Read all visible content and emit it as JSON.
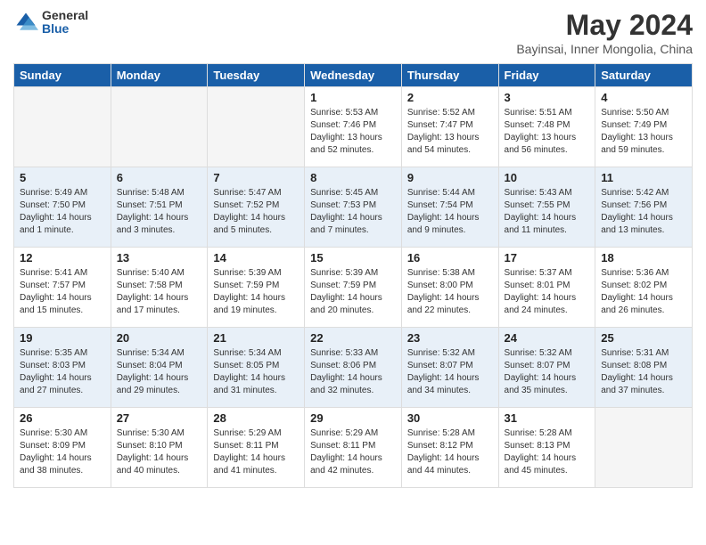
{
  "logo": {
    "general": "General",
    "blue": "Blue"
  },
  "title": "May 2024",
  "location": "Bayinsai, Inner Mongolia, China",
  "headers": [
    "Sunday",
    "Monday",
    "Tuesday",
    "Wednesday",
    "Thursday",
    "Friday",
    "Saturday"
  ],
  "weeks": [
    [
      {
        "day": "",
        "sunrise": "",
        "sunset": "",
        "daylight": "",
        "empty": true
      },
      {
        "day": "",
        "sunrise": "",
        "sunset": "",
        "daylight": "",
        "empty": true
      },
      {
        "day": "",
        "sunrise": "",
        "sunset": "",
        "daylight": "",
        "empty": true
      },
      {
        "day": "1",
        "sunrise": "Sunrise: 5:53 AM",
        "sunset": "Sunset: 7:46 PM",
        "daylight": "Daylight: 13 hours and 52 minutes.",
        "empty": false
      },
      {
        "day": "2",
        "sunrise": "Sunrise: 5:52 AM",
        "sunset": "Sunset: 7:47 PM",
        "daylight": "Daylight: 13 hours and 54 minutes.",
        "empty": false
      },
      {
        "day": "3",
        "sunrise": "Sunrise: 5:51 AM",
        "sunset": "Sunset: 7:48 PM",
        "daylight": "Daylight: 13 hours and 56 minutes.",
        "empty": false
      },
      {
        "day": "4",
        "sunrise": "Sunrise: 5:50 AM",
        "sunset": "Sunset: 7:49 PM",
        "daylight": "Daylight: 13 hours and 59 minutes.",
        "empty": false
      }
    ],
    [
      {
        "day": "5",
        "sunrise": "Sunrise: 5:49 AM",
        "sunset": "Sunset: 7:50 PM",
        "daylight": "Daylight: 14 hours and 1 minute.",
        "empty": false
      },
      {
        "day": "6",
        "sunrise": "Sunrise: 5:48 AM",
        "sunset": "Sunset: 7:51 PM",
        "daylight": "Daylight: 14 hours and 3 minutes.",
        "empty": false
      },
      {
        "day": "7",
        "sunrise": "Sunrise: 5:47 AM",
        "sunset": "Sunset: 7:52 PM",
        "daylight": "Daylight: 14 hours and 5 minutes.",
        "empty": false
      },
      {
        "day": "8",
        "sunrise": "Sunrise: 5:45 AM",
        "sunset": "Sunset: 7:53 PM",
        "daylight": "Daylight: 14 hours and 7 minutes.",
        "empty": false
      },
      {
        "day": "9",
        "sunrise": "Sunrise: 5:44 AM",
        "sunset": "Sunset: 7:54 PM",
        "daylight": "Daylight: 14 hours and 9 minutes.",
        "empty": false
      },
      {
        "day": "10",
        "sunrise": "Sunrise: 5:43 AM",
        "sunset": "Sunset: 7:55 PM",
        "daylight": "Daylight: 14 hours and 11 minutes.",
        "empty": false
      },
      {
        "day": "11",
        "sunrise": "Sunrise: 5:42 AM",
        "sunset": "Sunset: 7:56 PM",
        "daylight": "Daylight: 14 hours and 13 minutes.",
        "empty": false
      }
    ],
    [
      {
        "day": "12",
        "sunrise": "Sunrise: 5:41 AM",
        "sunset": "Sunset: 7:57 PM",
        "daylight": "Daylight: 14 hours and 15 minutes.",
        "empty": false
      },
      {
        "day": "13",
        "sunrise": "Sunrise: 5:40 AM",
        "sunset": "Sunset: 7:58 PM",
        "daylight": "Daylight: 14 hours and 17 minutes.",
        "empty": false
      },
      {
        "day": "14",
        "sunrise": "Sunrise: 5:39 AM",
        "sunset": "Sunset: 7:59 PM",
        "daylight": "Daylight: 14 hours and 19 minutes.",
        "empty": false
      },
      {
        "day": "15",
        "sunrise": "Sunrise: 5:39 AM",
        "sunset": "Sunset: 7:59 PM",
        "daylight": "Daylight: 14 hours and 20 minutes.",
        "empty": false
      },
      {
        "day": "16",
        "sunrise": "Sunrise: 5:38 AM",
        "sunset": "Sunset: 8:00 PM",
        "daylight": "Daylight: 14 hours and 22 minutes.",
        "empty": false
      },
      {
        "day": "17",
        "sunrise": "Sunrise: 5:37 AM",
        "sunset": "Sunset: 8:01 PM",
        "daylight": "Daylight: 14 hours and 24 minutes.",
        "empty": false
      },
      {
        "day": "18",
        "sunrise": "Sunrise: 5:36 AM",
        "sunset": "Sunset: 8:02 PM",
        "daylight": "Daylight: 14 hours and 26 minutes.",
        "empty": false
      }
    ],
    [
      {
        "day": "19",
        "sunrise": "Sunrise: 5:35 AM",
        "sunset": "Sunset: 8:03 PM",
        "daylight": "Daylight: 14 hours and 27 minutes.",
        "empty": false
      },
      {
        "day": "20",
        "sunrise": "Sunrise: 5:34 AM",
        "sunset": "Sunset: 8:04 PM",
        "daylight": "Daylight: 14 hours and 29 minutes.",
        "empty": false
      },
      {
        "day": "21",
        "sunrise": "Sunrise: 5:34 AM",
        "sunset": "Sunset: 8:05 PM",
        "daylight": "Daylight: 14 hours and 31 minutes.",
        "empty": false
      },
      {
        "day": "22",
        "sunrise": "Sunrise: 5:33 AM",
        "sunset": "Sunset: 8:06 PM",
        "daylight": "Daylight: 14 hours and 32 minutes.",
        "empty": false
      },
      {
        "day": "23",
        "sunrise": "Sunrise: 5:32 AM",
        "sunset": "Sunset: 8:07 PM",
        "daylight": "Daylight: 14 hours and 34 minutes.",
        "empty": false
      },
      {
        "day": "24",
        "sunrise": "Sunrise: 5:32 AM",
        "sunset": "Sunset: 8:07 PM",
        "daylight": "Daylight: 14 hours and 35 minutes.",
        "empty": false
      },
      {
        "day": "25",
        "sunrise": "Sunrise: 5:31 AM",
        "sunset": "Sunset: 8:08 PM",
        "daylight": "Daylight: 14 hours and 37 minutes.",
        "empty": false
      }
    ],
    [
      {
        "day": "26",
        "sunrise": "Sunrise: 5:30 AM",
        "sunset": "Sunset: 8:09 PM",
        "daylight": "Daylight: 14 hours and 38 minutes.",
        "empty": false
      },
      {
        "day": "27",
        "sunrise": "Sunrise: 5:30 AM",
        "sunset": "Sunset: 8:10 PM",
        "daylight": "Daylight: 14 hours and 40 minutes.",
        "empty": false
      },
      {
        "day": "28",
        "sunrise": "Sunrise: 5:29 AM",
        "sunset": "Sunset: 8:11 PM",
        "daylight": "Daylight: 14 hours and 41 minutes.",
        "empty": false
      },
      {
        "day": "29",
        "sunrise": "Sunrise: 5:29 AM",
        "sunset": "Sunset: 8:11 PM",
        "daylight": "Daylight: 14 hours and 42 minutes.",
        "empty": false
      },
      {
        "day": "30",
        "sunrise": "Sunrise: 5:28 AM",
        "sunset": "Sunset: 8:12 PM",
        "daylight": "Daylight: 14 hours and 44 minutes.",
        "empty": false
      },
      {
        "day": "31",
        "sunrise": "Sunrise: 5:28 AM",
        "sunset": "Sunset: 8:13 PM",
        "daylight": "Daylight: 14 hours and 45 minutes.",
        "empty": false
      },
      {
        "day": "",
        "sunrise": "",
        "sunset": "",
        "daylight": "",
        "empty": true
      }
    ]
  ]
}
